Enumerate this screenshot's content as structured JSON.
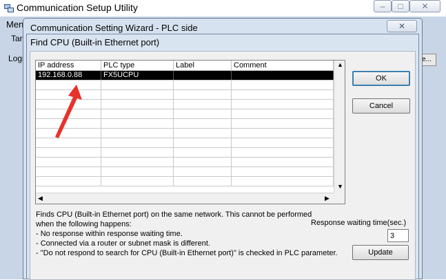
{
  "app": {
    "title": "Communication Setup Utility",
    "menu_label": "Men",
    "tab_label": "Tar",
    "login_label": "Logi",
    "right_button_label": "e..."
  },
  "wizard": {
    "title": "Communication Setting Wizard - PLC side",
    "close_glyph": "✕"
  },
  "dialog": {
    "title": "Find CPU (Built-in Ethernet port)"
  },
  "table": {
    "columns": [
      "IP address",
      "PLC type",
      "Label",
      "Comment"
    ],
    "rows": [
      {
        "ip": "192.168.0.88",
        "plc_type": "FX5UCPU",
        "label": "",
        "comment": ""
      }
    ]
  },
  "buttons": {
    "ok": "OK",
    "cancel": "Cancel",
    "update": "Update"
  },
  "description": "Finds CPU (Built-in Ethernet port) on the same network. This cannot be performed\nwhen the following happens:\n- No response within response waiting time.\n- Connected via a router or subnet mask is different.\n- \"Do not respond to search for CPU (Built-in Ethernet port)\" is checked in PLC parameter.",
  "response": {
    "label": "Response waiting time(sec.)",
    "value": "3"
  },
  "colors": {
    "annotation_arrow": "#e8322b",
    "selection": "#000000"
  }
}
